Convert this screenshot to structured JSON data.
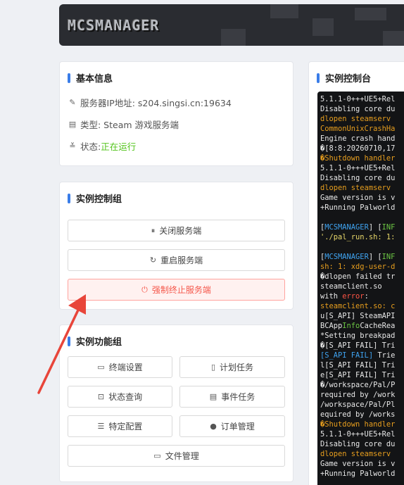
{
  "app": {
    "logo_text": "MCSMANAGER"
  },
  "basic_info": {
    "title": "基本信息",
    "server_ip_label": "服务器IP地址: s204.singsi.cn:19634",
    "type_label": "类型: Steam 游戏服务端",
    "status_prefix": "状态: ",
    "status_value": "正在运行",
    "status_color": "#52c41a"
  },
  "control_group": {
    "title": "实例控制组",
    "stop_label": "关闭服务端",
    "restart_label": "重启服务端",
    "kill_label": "强制终止服务端"
  },
  "function_group": {
    "title": "实例功能组",
    "terminal_settings": "终端设置",
    "scheduled_tasks": "计划任务",
    "status_query": "状态查询",
    "event_tasks": "事件任务",
    "specific_config": "特定配置",
    "order_management": "订单管理",
    "file_management": "文件管理"
  },
  "console": {
    "title": "实例控制台",
    "lines": [
      [
        {
          "t": "5.1.1-0+++UE5+Rel",
          "c": "w"
        }
      ],
      [
        {
          "t": "Disabling core du",
          "c": "w"
        }
      ],
      [
        {
          "t": "dlopen steamserv",
          "c": "o"
        }
      ],
      [
        {
          "t": "CommonUnixCrashHa",
          "c": "o"
        }
      ],
      [
        {
          "t": "Engine crash hand",
          "c": "w"
        }
      ],
      [
        {
          "t": "�[8:8:20260710,17",
          "c": "w"
        }
      ],
      [
        {
          "t": "�Shutdown handler",
          "c": "o"
        }
      ],
      [
        {
          "t": "5.1.1-0+++UE5+Rel",
          "c": "w"
        }
      ],
      [
        {
          "t": "Disabling core du",
          "c": "w"
        }
      ],
      [
        {
          "t": "dlopen steamserv",
          "c": "o"
        }
      ],
      [
        {
          "t": "Game version is v",
          "c": "w"
        }
      ],
      [
        {
          "t": "+Running Palworld",
          "c": "w"
        }
      ],
      [
        {
          "t": "",
          "c": "w"
        }
      ],
      [
        {
          "t": "[",
          "c": "w"
        },
        {
          "t": "MCSMANAGER",
          "c": "b"
        },
        {
          "t": "] [",
          "c": "w"
        },
        {
          "t": "INF",
          "c": "g"
        }
      ],
      [
        {
          "t": "'./pal_run.sh: 1:",
          "c": "y"
        }
      ],
      [
        {
          "t": "",
          "c": "w"
        }
      ],
      [
        {
          "t": "[",
          "c": "w"
        },
        {
          "t": "MCSMANAGER",
          "c": "b"
        },
        {
          "t": "] [",
          "c": "w"
        },
        {
          "t": "INF",
          "c": "g"
        }
      ],
      [
        {
          "t": "sh: 1: xdg-user-d",
          "c": "o"
        }
      ],
      [
        {
          "t": "�dlopen failed tr",
          "c": "w"
        }
      ],
      [
        {
          "t": "steamclient.so",
          "c": "w"
        }
      ],
      [
        {
          "t": "with ",
          "c": "w"
        },
        {
          "t": "error",
          "c": "r"
        },
        {
          "t": ":",
          "c": "w"
        }
      ],
      [
        {
          "t": "steamclient.so: c",
          "c": "o"
        }
      ],
      [
        {
          "t": "u[S_API] SteamAPI",
          "c": "w"
        }
      ],
      [
        {
          "t": "BCApp",
          "c": "w"
        },
        {
          "t": "Info",
          "c": "g"
        },
        {
          "t": "CacheRea",
          "c": "w"
        }
      ],
      [
        {
          "t": "*Setting breakpad",
          "c": "w"
        }
      ],
      [
        {
          "t": "�[S_API FAIL] Tri",
          "c": "w"
        }
      ],
      [
        {
          "t": "[S_API FAIL]",
          "c": "b"
        },
        {
          "t": " Trie",
          "c": "w"
        }
      ],
      [
        {
          "t": "l[S_API FAIL] Tri",
          "c": "w"
        }
      ],
      [
        {
          "t": "e[S_API FAIL] Tri",
          "c": "w"
        }
      ],
      [
        {
          "t": "�/workspace/Pal/P",
          "c": "w"
        }
      ],
      [
        {
          "t": "required by /work",
          "c": "w"
        }
      ],
      [
        {
          "t": "/workspace/Pal/Pl",
          "c": "w"
        }
      ],
      [
        {
          "t": "equired by /works",
          "c": "w"
        }
      ],
      [
        {
          "t": "�Shutdown handler",
          "c": "o"
        }
      ],
      [
        {
          "t": "5.1.1-0+++UE5+Rel",
          "c": "w"
        }
      ],
      [
        {
          "t": "Disabling core du",
          "c": "w"
        }
      ],
      [
        {
          "t": "dlopen steamserv",
          "c": "o"
        }
      ],
      [
        {
          "t": "Game version is v",
          "c": "w"
        }
      ],
      [
        {
          "t": "+Running Palworld",
          "c": "w"
        }
      ]
    ]
  },
  "colors": {
    "accent": "#3a7de8",
    "danger": "#f5584c",
    "arrow": "#e8453a"
  }
}
